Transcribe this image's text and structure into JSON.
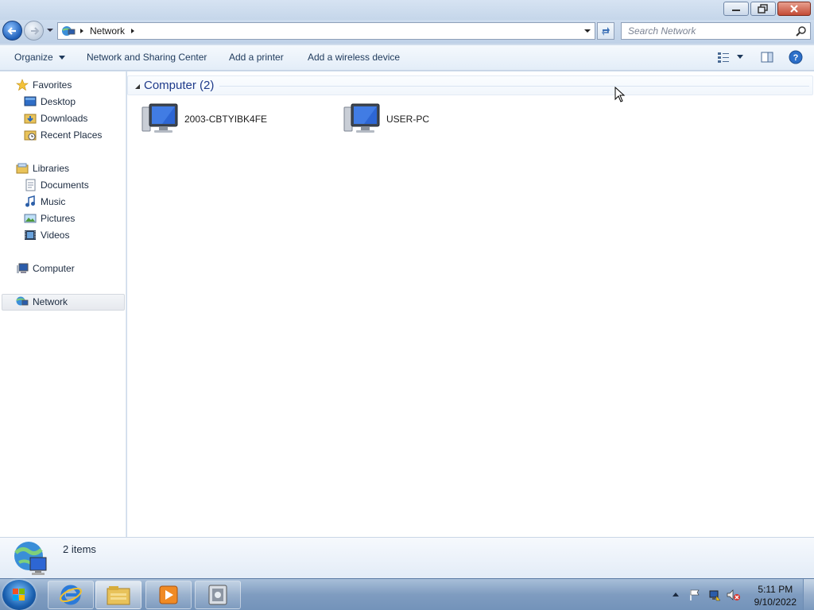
{
  "window": {
    "controls": {
      "minimize": "minimize",
      "restore": "restore",
      "close": "close"
    }
  },
  "address": {
    "breadcrumb": [
      "Network"
    ],
    "search_placeholder": "Search Network"
  },
  "toolbar": {
    "organize": "Organize",
    "network_sharing": "Network and Sharing Center",
    "add_printer": "Add a printer",
    "add_wireless": "Add a wireless device"
  },
  "nav": {
    "favorites": "Favorites",
    "desktop": "Desktop",
    "downloads": "Downloads",
    "recent": "Recent Places",
    "libraries": "Libraries",
    "documents": "Documents",
    "music": "Music",
    "pictures": "Pictures",
    "videos": "Videos",
    "computer": "Computer",
    "network": "Network",
    "selected": "network"
  },
  "content": {
    "group_title": "Computer (2)",
    "items": [
      {
        "name": "2003-CBTYIBK4FE",
        "icon": "computer-icon"
      },
      {
        "name": "USER-PC",
        "icon": "computer-icon"
      }
    ]
  },
  "details": {
    "count": "2 items"
  },
  "taskbar": {
    "apps": [
      "internet-explorer-icon",
      "windows-explorer-icon",
      "media-player-icon",
      "app-icon"
    ]
  },
  "clock": {
    "time": "5:11 PM",
    "date": "9/10/2022"
  },
  "colors": {
    "accent": "#1e3a8a",
    "taskbar": "#7f9cc0"
  }
}
